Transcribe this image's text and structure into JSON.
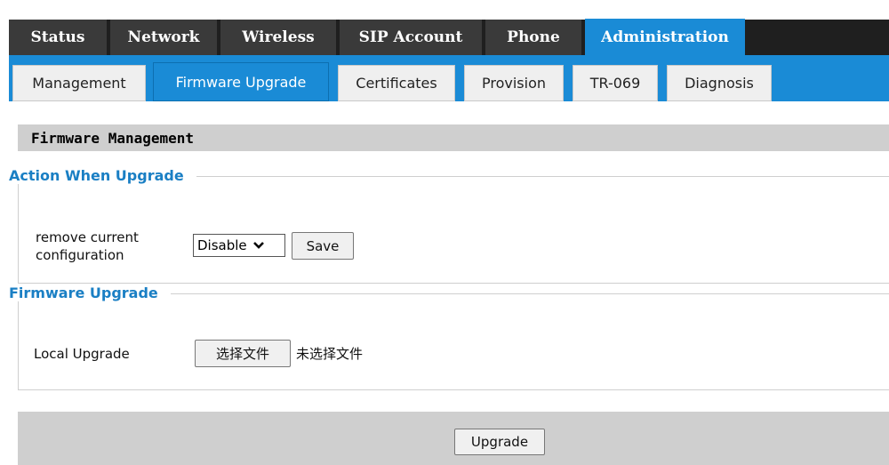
{
  "main_tabs": [
    {
      "label": "Status",
      "active": false
    },
    {
      "label": "Network",
      "active": false
    },
    {
      "label": "Wireless",
      "active": false
    },
    {
      "label": "SIP Account",
      "active": false
    },
    {
      "label": "Phone",
      "active": false
    },
    {
      "label": "Administration",
      "active": true
    }
  ],
  "sub_tabs": [
    {
      "label": "Management",
      "active": false
    },
    {
      "label": "Firmware Upgrade",
      "active": true
    },
    {
      "label": "Certificates",
      "active": false
    },
    {
      "label": "Provision",
      "active": false
    },
    {
      "label": "TR-069",
      "active": false
    },
    {
      "label": "Diagnosis",
      "active": false
    }
  ],
  "section_title": "Firmware Management",
  "action_group": {
    "legend": "Action When Upgrade",
    "label_line1": "remove current",
    "label_line2": "configuration",
    "select_value": "Disable",
    "save_label": "Save"
  },
  "upgrade_group": {
    "legend": "Firmware Upgrade",
    "label": "Local Upgrade",
    "file_button": "选择文件",
    "file_status": "未选择文件"
  },
  "footer": {
    "upgrade_button": "Upgrade"
  },
  "colors": {
    "accent": "#1a8bd6",
    "dark_tab": "#3a3a3a",
    "gray_bar": "#cfcfcf"
  }
}
